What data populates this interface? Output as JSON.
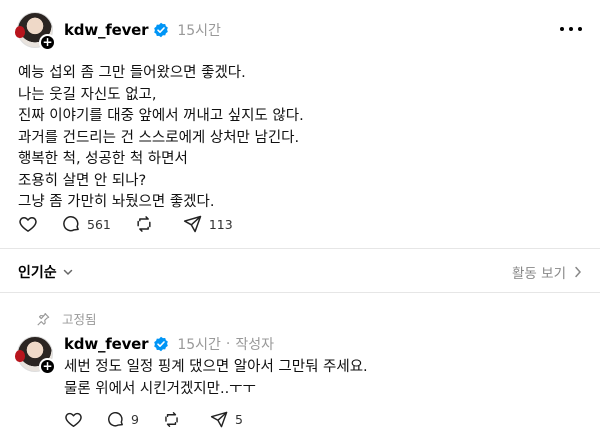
{
  "post": {
    "username": "kdw_fever",
    "time": "15시간",
    "lines": [
      "예능 섭외 좀 그만 들어왔으면 좋겠다.",
      "나는 웃길 자신도 없고,",
      "진짜 이야기를 대중 앞에서 꺼내고 싶지도 않다.",
      "과거를 건드리는 건 스스로에게 상처만 남긴다.",
      "행복한 척, 성공한 척 하면서",
      "조용히 살면 안 되나?",
      "그냥 좀 가만히 놔뒀으면 좋겠다."
    ],
    "replies": "561",
    "reposts": "",
    "shares": "113"
  },
  "sort": {
    "label": "인기순",
    "activity": "활동 보기"
  },
  "pinned": {
    "label": "고정됨"
  },
  "reply": {
    "username": "kdw_fever",
    "time": "15시간",
    "separator": "·",
    "author_tag": "작성자",
    "lines": [
      "세번 정도 일정 핑계 댔으면 알아서 그만둬 주세요.",
      "물론 위에서 시킨거겠지만..ㅜㅜ"
    ],
    "replies": "9",
    "reposts": "",
    "shares": "5"
  },
  "colors": {
    "verified": "#0095f6",
    "muted": "#999999",
    "divider": "#e6e6e6"
  }
}
